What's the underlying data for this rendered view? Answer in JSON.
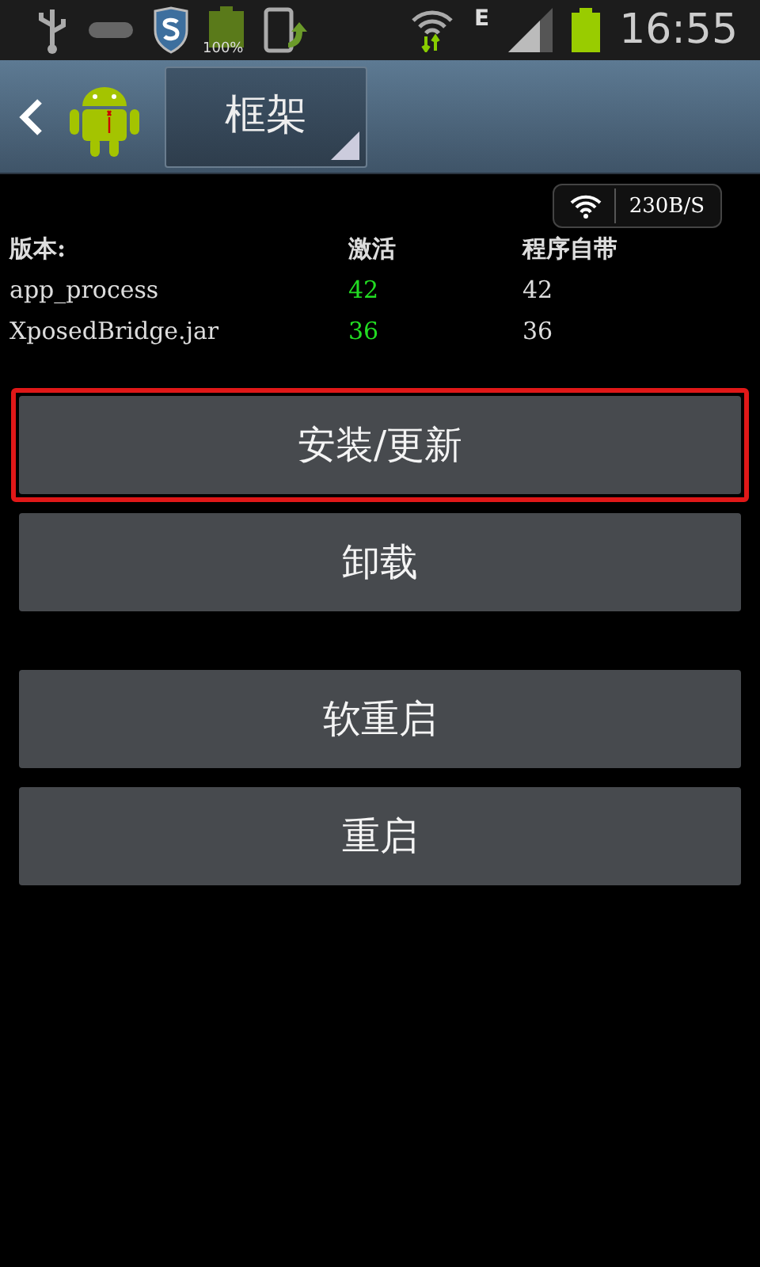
{
  "status_bar": {
    "battery_label": "100%",
    "network_type": "E",
    "time": "16:55"
  },
  "header": {
    "title": "框架"
  },
  "speed_widget": {
    "reading": "230B/S"
  },
  "versions": {
    "columns": [
      "版本:",
      "激活",
      "程序自带"
    ],
    "rows": [
      {
        "name": "app_process",
        "active": "42",
        "bundled": "42"
      },
      {
        "name": "XposedBridge.jar",
        "active": "36",
        "bundled": "36"
      }
    ]
  },
  "button_groups": [
    {
      "buttons": [
        {
          "label": "安装/更新",
          "highlighted": true
        },
        {
          "label": "卸载",
          "highlighted": false
        }
      ]
    },
    {
      "buttons": [
        {
          "label": "软重启",
          "highlighted": false
        },
        {
          "label": "重启",
          "highlighted": false
        }
      ]
    }
  ]
}
